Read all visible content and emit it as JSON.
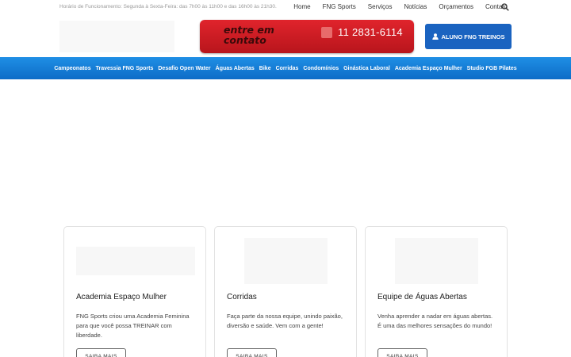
{
  "topbar": {
    "hours": "Horário de Funcionamento: Segunda à Sexta-Feira: das 7h00 às 11h00 e das 16h00 às 21h30.",
    "nav": [
      "Home",
      "FNG Sports",
      "Serviços",
      "Notícias",
      "Orçamentos",
      "Contato"
    ],
    "search_icon": "search-icon"
  },
  "header": {
    "cta_text": "entre em contato",
    "phone": "11 2831-6114",
    "aluno_button": "ALUNO FNG TREINOS",
    "colors": {
      "cta_red": "#d11e26",
      "aluno_blue": "#1a63c0"
    }
  },
  "navbar": {
    "items": [
      "Campeonatos",
      "Travessia FNG Sports",
      "Desafio Open Water",
      "Águas Abertas",
      "Bike",
      "Corridas",
      "Condomínios",
      "Ginástica Laboral",
      "Academia Espaço Mulher",
      "Studio FGB Pilates"
    ],
    "color": "#1479d6"
  },
  "cards": [
    {
      "title": "Academia Espaço Mulher",
      "desc": "FNG Sports criou uma Academia Feminina para que você possa TREINAR com liberdade.",
      "button": "SAIBA MAIS"
    },
    {
      "title": "Corridas",
      "desc": "Faça parte da nossa equipe, unindo paixão, diversão e saúde. Vem com a gente!",
      "button": "SAIBA MAIS"
    },
    {
      "title": "Equipe de Águas Abertas",
      "desc": "Venha aprender a nadar em águas abertas. É uma das melhores sensações do mundo!",
      "button": "SAIBA MAIS"
    }
  ]
}
